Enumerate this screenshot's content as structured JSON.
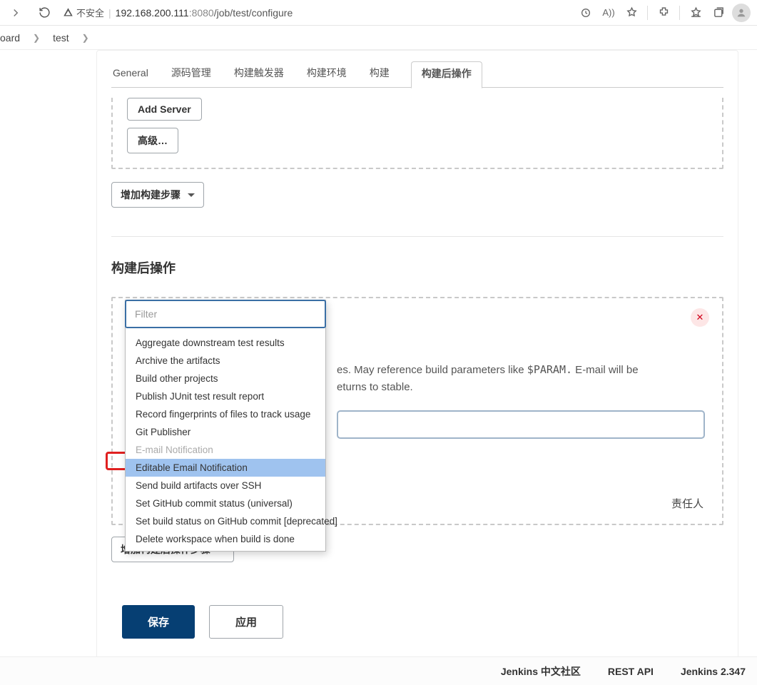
{
  "browser": {
    "insecure_label": "不安全",
    "url_host": "192.168.200.111",
    "url_port": ":8080",
    "url_path": "/job/test/configure"
  },
  "breadcrumb": {
    "items": [
      "oard",
      "test"
    ]
  },
  "tabs": {
    "items": [
      "General",
      "源码管理",
      "构建触发器",
      "构建环境",
      "构建",
      "构建后操作"
    ],
    "active_index": 5
  },
  "build_panel": {
    "add_server_label": "Add Server",
    "advanced_label": "高级…",
    "add_step_label": "增加构建步骤"
  },
  "post_build": {
    "title": "构建后操作",
    "desc_mid": "es. May reference build parameters like ",
    "desc_param": "$PARAM.",
    "desc_tail": " E-mail will be",
    "desc_line2": "eturns to stable.",
    "trailer": "责任人",
    "add_label": "增加构建后操作步骤"
  },
  "dropdown": {
    "filter_placeholder": "Filter",
    "items": [
      {
        "label": "Aggregate downstream test results",
        "state": "normal"
      },
      {
        "label": "Archive the artifacts",
        "state": "normal"
      },
      {
        "label": "Build other projects",
        "state": "normal"
      },
      {
        "label": "Publish JUnit test result report",
        "state": "normal"
      },
      {
        "label": "Record fingerprints of files to track usage",
        "state": "normal"
      },
      {
        "label": "Git Publisher",
        "state": "normal"
      },
      {
        "label": "E-mail Notification",
        "state": "disabled"
      },
      {
        "label": "Editable Email Notification",
        "state": "highlight"
      },
      {
        "label": "Send build artifacts over SSH",
        "state": "normal"
      },
      {
        "label": "Set GitHub commit status (universal)",
        "state": "normal"
      },
      {
        "label": "Set build status on GitHub commit [deprecated]",
        "state": "normal"
      },
      {
        "label": "Delete workspace when build is done",
        "state": "normal"
      }
    ]
  },
  "buttons": {
    "save": "保存",
    "apply": "应用"
  },
  "footer": {
    "community": "Jenkins 中文社区",
    "rest": "REST API",
    "version": "Jenkins 2.347"
  }
}
